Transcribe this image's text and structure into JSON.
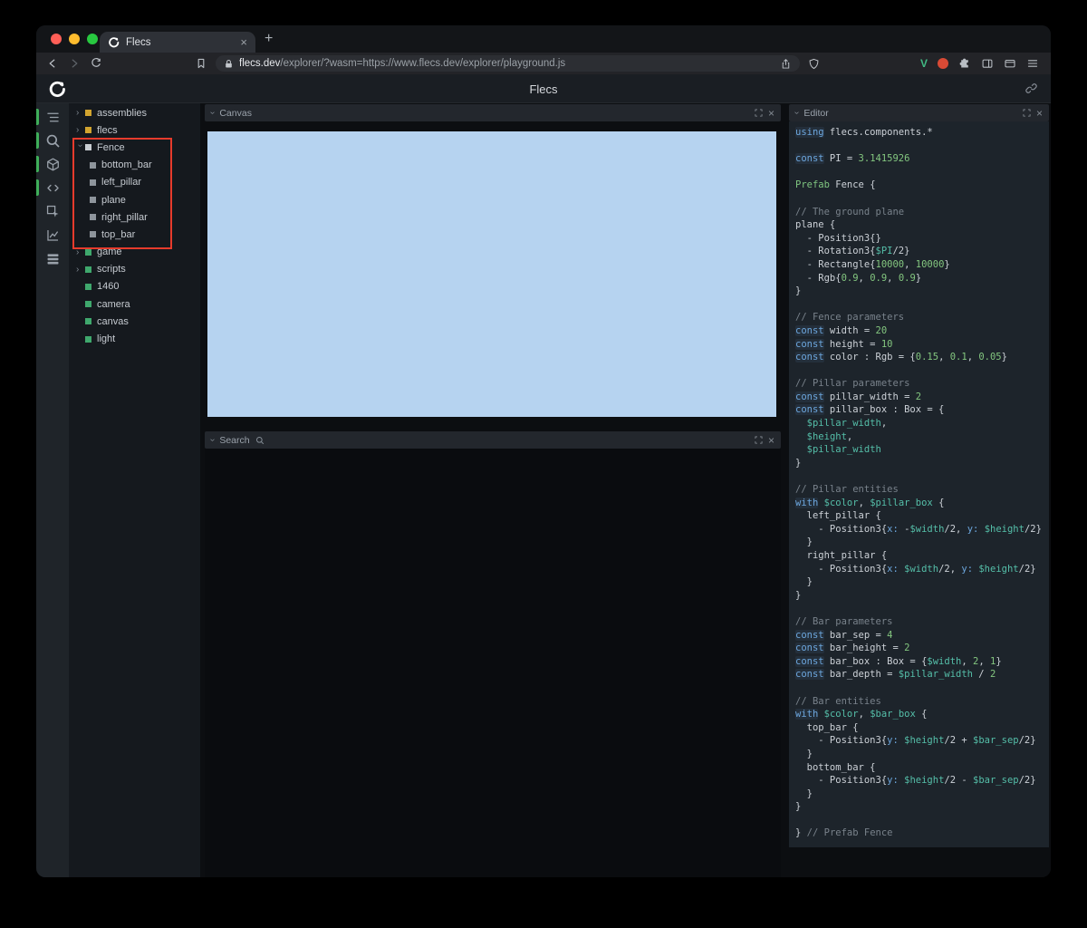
{
  "browser": {
    "tab_title": "Flecs",
    "url_host": "flecs.dev",
    "url_rest": "/explorer/?wasm=https://www.flecs.dev/explorer/playground.js"
  },
  "app": {
    "title": "Flecs"
  },
  "icons": {
    "close": "×",
    "chevron": "›",
    "plus": "+",
    "vue": "V"
  },
  "icon_strip": [
    {
      "name": "entity-tree",
      "active": true
    },
    {
      "name": "query-search",
      "active": true
    },
    {
      "name": "canvas-3d",
      "active": true
    },
    {
      "name": "code-editor",
      "active": true
    },
    {
      "name": "inspector",
      "active": false
    },
    {
      "name": "statistics",
      "active": false
    },
    {
      "name": "commands",
      "active": false
    }
  ],
  "tree": {
    "items": [
      {
        "label": "assemblies",
        "square": "yellow",
        "arrow": "collapsed",
        "depth": 0
      },
      {
        "label": "flecs",
        "square": "yellow",
        "arrow": "collapsed",
        "depth": 0
      },
      {
        "label": "Fence",
        "square": "white",
        "arrow": "expanded",
        "depth": 0
      },
      {
        "label": "bottom_bar",
        "square": "gray",
        "arrow": "none",
        "depth": 1
      },
      {
        "label": "left_pillar",
        "square": "gray",
        "arrow": "none",
        "depth": 1
      },
      {
        "label": "plane",
        "square": "gray",
        "arrow": "none",
        "depth": 1
      },
      {
        "label": "right_pillar",
        "square": "gray",
        "arrow": "none",
        "depth": 1
      },
      {
        "label": "top_bar",
        "square": "gray",
        "arrow": "none",
        "depth": 1
      },
      {
        "label": "game",
        "square": "green",
        "arrow": "collapsed",
        "depth": 0
      },
      {
        "label": "scripts",
        "square": "green",
        "arrow": "collapsed",
        "depth": 0
      },
      {
        "label": "1460",
        "square": "green",
        "arrow": "none",
        "depth": 0
      },
      {
        "label": "camera",
        "square": "green",
        "arrow": "none",
        "depth": 0
      },
      {
        "label": "canvas",
        "square": "green",
        "arrow": "none",
        "depth": 0
      },
      {
        "label": "light",
        "square": "green",
        "arrow": "none",
        "depth": 0
      }
    ]
  },
  "panels": {
    "canvas": {
      "title": "Canvas"
    },
    "search": {
      "title": "Search"
    },
    "editor": {
      "title": "Editor"
    }
  },
  "colors": {
    "traffic_red": "#ff5f57",
    "traffic_yellow": "#febc2e",
    "traffic_green": "#28c840",
    "canvas_sky": "#b6d3f0",
    "annotation_red": "#e63b2c",
    "panel_active_green": "#3fae5a",
    "square_yellow": "#d2a42f",
    "square_green": "#3fa86d",
    "square_gray": "#8e959c",
    "square_white": "#c9ced3",
    "vue_green": "#41b883",
    "ext_red": "#d84a35"
  },
  "code": {
    "lines": [
      [
        [
          "kw",
          "using"
        ],
        [
          "pl",
          " flecs.components.*"
        ]
      ],
      [],
      [
        [
          "kw",
          "const"
        ],
        [
          "pl",
          " PI = "
        ],
        [
          "num",
          "3.1415926"
        ]
      ],
      [],
      [
        [
          "kw2",
          "Prefab"
        ],
        [
          "pl",
          " Fence {"
        ]
      ],
      [],
      [
        [
          "cm",
          "// The ground plane"
        ]
      ],
      [
        [
          "pl",
          "plane {"
        ]
      ],
      [
        [
          "pl",
          "  - Position3{}"
        ]
      ],
      [
        [
          "pl",
          "  - Rotation3{"
        ],
        [
          "var",
          "$PI"
        ],
        [
          "pl",
          "/2}"
        ]
      ],
      [
        [
          "pl",
          "  - Rectangle{"
        ],
        [
          "num",
          "10000"
        ],
        [
          "pl",
          ", "
        ],
        [
          "num",
          "10000"
        ],
        [
          "pl",
          "}"
        ]
      ],
      [
        [
          "pl",
          "  - Rgb{"
        ],
        [
          "num",
          "0.9"
        ],
        [
          "pl",
          ", "
        ],
        [
          "num",
          "0.9"
        ],
        [
          "pl",
          ", "
        ],
        [
          "num",
          "0.9"
        ],
        [
          "pl",
          "}"
        ]
      ],
      [
        [
          "pl",
          "}"
        ]
      ],
      [],
      [
        [
          "cm",
          "// Fence parameters"
        ]
      ],
      [
        [
          "kw",
          "const"
        ],
        [
          "pl",
          " width = "
        ],
        [
          "num",
          "20"
        ]
      ],
      [
        [
          "kw",
          "const"
        ],
        [
          "pl",
          " height = "
        ],
        [
          "num",
          "10"
        ]
      ],
      [
        [
          "kw",
          "const"
        ],
        [
          "pl",
          " color : Rgb = {"
        ],
        [
          "num",
          "0.15"
        ],
        [
          "pl",
          ", "
        ],
        [
          "num",
          "0.1"
        ],
        [
          "pl",
          ", "
        ],
        [
          "num",
          "0.05"
        ],
        [
          "pl",
          "}"
        ]
      ],
      [],
      [
        [
          "cm",
          "// Pillar parameters"
        ]
      ],
      [
        [
          "kw",
          "const"
        ],
        [
          "pl",
          " pillar_width = "
        ],
        [
          "num",
          "2"
        ]
      ],
      [
        [
          "kw",
          "const"
        ],
        [
          "pl",
          " pillar_box : Box = {"
        ]
      ],
      [
        [
          "pl",
          "  "
        ],
        [
          "var",
          "$pillar_width"
        ],
        [
          "pl",
          ","
        ]
      ],
      [
        [
          "pl",
          "  "
        ],
        [
          "var",
          "$height"
        ],
        [
          "pl",
          ","
        ]
      ],
      [
        [
          "pl",
          "  "
        ],
        [
          "var",
          "$pillar_width"
        ]
      ],
      [
        [
          "pl",
          "}"
        ]
      ],
      [],
      [
        [
          "cm",
          "// Pillar entities"
        ]
      ],
      [
        [
          "kw",
          "with"
        ],
        [
          "pl",
          " "
        ],
        [
          "var",
          "$color"
        ],
        [
          "pl",
          ", "
        ],
        [
          "var",
          "$pillar_box"
        ],
        [
          "pl",
          " {"
        ]
      ],
      [
        [
          "pl",
          "  left_pillar {"
        ]
      ],
      [
        [
          "pl",
          "    - Position3{"
        ],
        [
          "key",
          "x:"
        ],
        [
          "pl",
          " -"
        ],
        [
          "var",
          "$width"
        ],
        [
          "pl",
          "/2, "
        ],
        [
          "key",
          "y:"
        ],
        [
          "pl",
          " "
        ],
        [
          "var",
          "$height"
        ],
        [
          "pl",
          "/2}"
        ]
      ],
      [
        [
          "pl",
          "  }"
        ]
      ],
      [
        [
          "pl",
          "  right_pillar {"
        ]
      ],
      [
        [
          "pl",
          "    - Position3{"
        ],
        [
          "key",
          "x:"
        ],
        [
          "pl",
          " "
        ],
        [
          "var",
          "$width"
        ],
        [
          "pl",
          "/2, "
        ],
        [
          "key",
          "y:"
        ],
        [
          "pl",
          " "
        ],
        [
          "var",
          "$height"
        ],
        [
          "pl",
          "/2}"
        ]
      ],
      [
        [
          "pl",
          "  }"
        ]
      ],
      [
        [
          "pl",
          "}"
        ]
      ],
      [],
      [
        [
          "cm",
          "// Bar parameters"
        ]
      ],
      [
        [
          "kw",
          "const"
        ],
        [
          "pl",
          " bar_sep = "
        ],
        [
          "num",
          "4"
        ]
      ],
      [
        [
          "kw",
          "const"
        ],
        [
          "pl",
          " bar_height = "
        ],
        [
          "num",
          "2"
        ]
      ],
      [
        [
          "kw",
          "const"
        ],
        [
          "pl",
          " bar_box : Box = {"
        ],
        [
          "var",
          "$width"
        ],
        [
          "pl",
          ", "
        ],
        [
          "num",
          "2"
        ],
        [
          "pl",
          ", "
        ],
        [
          "num",
          "1"
        ],
        [
          "pl",
          "}"
        ]
      ],
      [
        [
          "kw",
          "const"
        ],
        [
          "pl",
          " bar_depth = "
        ],
        [
          "var",
          "$pillar_width"
        ],
        [
          "pl",
          " / "
        ],
        [
          "num",
          "2"
        ]
      ],
      [],
      [
        [
          "cm",
          "// Bar entities"
        ]
      ],
      [
        [
          "kw",
          "with"
        ],
        [
          "pl",
          " "
        ],
        [
          "var",
          "$color"
        ],
        [
          "pl",
          ", "
        ],
        [
          "var",
          "$bar_box"
        ],
        [
          "pl",
          " {"
        ]
      ],
      [
        [
          "pl",
          "  top_bar {"
        ]
      ],
      [
        [
          "pl",
          "    - Position3{"
        ],
        [
          "key",
          "y:"
        ],
        [
          "pl",
          " "
        ],
        [
          "var",
          "$height"
        ],
        [
          "pl",
          "/2 + "
        ],
        [
          "var",
          "$bar_sep"
        ],
        [
          "pl",
          "/2}"
        ]
      ],
      [
        [
          "pl",
          "  }"
        ]
      ],
      [
        [
          "pl",
          "  bottom_bar {"
        ]
      ],
      [
        [
          "pl",
          "    - Position3{"
        ],
        [
          "key",
          "y:"
        ],
        [
          "pl",
          " "
        ],
        [
          "var",
          "$height"
        ],
        [
          "pl",
          "/2 - "
        ],
        [
          "var",
          "$bar_sep"
        ],
        [
          "pl",
          "/2}"
        ]
      ],
      [
        [
          "pl",
          "  }"
        ]
      ],
      [
        [
          "pl",
          "}"
        ]
      ],
      [],
      [
        [
          "pl",
          "} "
        ],
        [
          "cm",
          "// Prefab Fence"
        ]
      ]
    ]
  }
}
